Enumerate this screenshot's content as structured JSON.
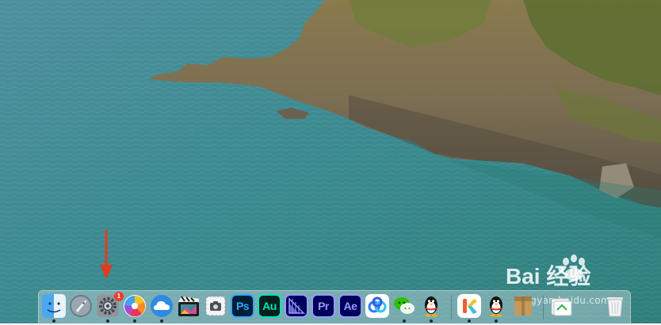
{
  "dock": {
    "apps": [
      {
        "name": "Finder",
        "icon": "finder-icon",
        "running": true
      },
      {
        "name": "Launchpad",
        "icon": "launchpad-rocket-icon",
        "running": false
      },
      {
        "name": "System Preferences",
        "icon": "gear-icon",
        "running": true,
        "badge": "1"
      },
      {
        "name": "Pinwheel App",
        "icon": "pinwheel-icon",
        "running": true
      },
      {
        "name": "Cloud App",
        "icon": "cloud-icon",
        "running": true
      },
      {
        "name": "Final Cut Pro",
        "icon": "clapperboard-icon",
        "running": false
      },
      {
        "name": "Screenshot",
        "icon": "camera-icon",
        "running": false
      },
      {
        "name": "Photoshop",
        "label": "Ps",
        "running": false
      },
      {
        "name": "Audition",
        "label": "Au",
        "running": false
      },
      {
        "name": "Media Encoder",
        "icon": "media-encoder-icon",
        "running": false
      },
      {
        "name": "Premiere Pro",
        "label": "Pr",
        "running": false
      },
      {
        "name": "After Effects",
        "label": "Ae",
        "running": false
      },
      {
        "name": "Baidu Netdisk",
        "icon": "cloud-rings-icon",
        "running": false
      },
      {
        "name": "WeChat",
        "icon": "wechat-bubbles-icon",
        "running": true
      },
      {
        "name": "QQ",
        "icon": "penguin-icon",
        "running": true
      },
      {
        "name": "K App",
        "label": "K",
        "running": true
      },
      {
        "name": "QQ",
        "icon": "penguin-icon",
        "running": true
      },
      {
        "name": "Archive Utility",
        "icon": "box-icon",
        "running": false
      },
      {
        "name": "Downloads",
        "icon": "downloads-stack-icon",
        "running": false
      },
      {
        "name": "Trash",
        "icon": "trash-icon",
        "running": false
      }
    ]
  },
  "watermark": {
    "logo": "Bai 经验",
    "url": "jingyan.baidu.com"
  },
  "colors": {
    "sea": "#3f8f92",
    "badge": "#f0392b",
    "arrow": "#e23b1d",
    "ps": "#31a8ff",
    "au": "#00e4bb",
    "pr": "#9999ff",
    "ae": "#9999ff"
  }
}
